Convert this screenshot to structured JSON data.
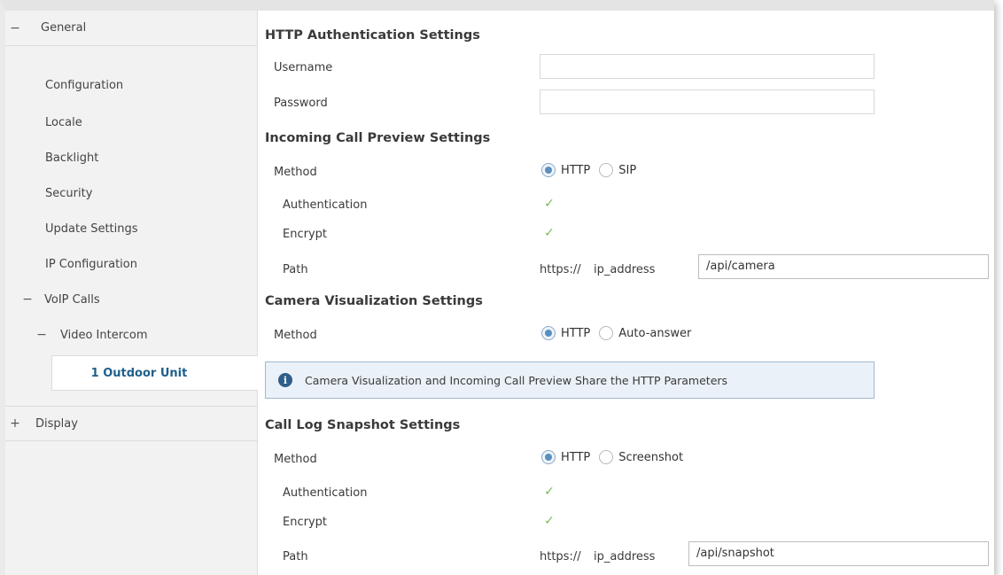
{
  "sidebar": {
    "general": {
      "toggle": "−",
      "label": "General"
    },
    "items": [
      {
        "label": "Configuration"
      },
      {
        "label": "Locale"
      },
      {
        "label": "Backlight"
      },
      {
        "label": "Security"
      },
      {
        "label": "Update Settings"
      },
      {
        "label": "IP Configuration"
      }
    ],
    "voip": {
      "toggle": "−",
      "label": "VoIP Calls"
    },
    "video": {
      "toggle": "−",
      "label": "Video Intercom"
    },
    "selected": {
      "label": "1 Outdoor Unit"
    },
    "display": {
      "toggle": "+",
      "label": "Display"
    }
  },
  "http_auth": {
    "title": "HTTP Authentication Settings",
    "username_label": "Username",
    "username_value": "",
    "password_label": "Password",
    "password_value": ""
  },
  "incoming_call": {
    "title": "Incoming Call Preview Settings",
    "method_label": "Method",
    "options": [
      "HTTP",
      "SIP"
    ],
    "selected": "HTTP",
    "auth_label": "Authentication",
    "auth_checked": true,
    "encrypt_label": "Encrypt",
    "encrypt_checked": true,
    "path_label": "Path",
    "path_prefix": "https://",
    "path_host": "ip_address",
    "path_value": "/api/camera"
  },
  "camera_vis": {
    "title": "Camera Visualization Settings",
    "method_label": "Method",
    "options": [
      "HTTP",
      "Auto-answer"
    ],
    "selected": "HTTP",
    "info_text": "Camera Visualization and Incoming Call Preview Share the HTTP Parameters"
  },
  "call_log": {
    "title": "Call Log Snapshot Settings",
    "method_label": "Method",
    "options": [
      "HTTP",
      "Screenshot"
    ],
    "selected": "HTTP",
    "auth_label": "Authentication",
    "auth_checked": true,
    "encrypt_label": "Encrypt",
    "encrypt_checked": true,
    "path_label": "Path",
    "path_prefix": "https://",
    "path_host": "ip_address",
    "path_value": "/api/snapshot"
  },
  "colors": {
    "accent": "#1f5f8b",
    "check": "#7dbb55",
    "info_bg": "#eaf1f8",
    "info_border": "#9fb9d1",
    "sidebar_bg": "#f2f2f2"
  },
  "icons": {
    "info": "info-icon",
    "check": "checkmark-icon"
  }
}
